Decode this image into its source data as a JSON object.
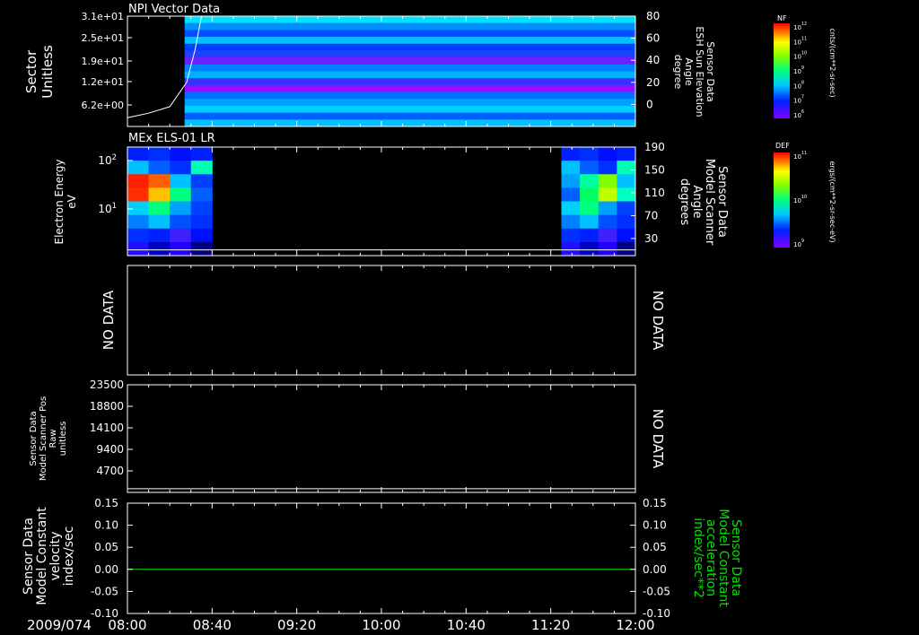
{
  "colors": {
    "background": "#000000",
    "foreground": "#ffffff",
    "green_axis": "#00e000"
  },
  "time_axis": {
    "date": "2009/074",
    "ticks": [
      "08:00",
      "08:40",
      "09:20",
      "10:00",
      "10:40",
      "11:20",
      "12:00"
    ]
  },
  "chart_data": [
    {
      "type": "heatmap",
      "title": "NPI Vector Data",
      "ylabel": [
        "Sector",
        "Unitless"
      ],
      "ytick_labels": [
        "3.1e+01",
        "2.5e+01",
        "1.9e+01",
        "1.2e+01",
        "6.2e+00"
      ],
      "y2label": [
        "Sensor Data",
        "ESH Sun Elevation",
        "Angle",
        "degree"
      ],
      "y2tick_labels": [
        "80",
        "60",
        "40",
        "20",
        "0"
      ],
      "y2lim": [
        -20,
        80
      ],
      "overlay_line": {
        "x": [
          "08:00",
          "08:10",
          "08:20",
          "08:28",
          "08:32",
          "08:35",
          "09:00",
          "10:00",
          "11:00",
          "11:50",
          "11:55",
          "12:00"
        ],
        "y": [
          -12,
          -8,
          -2,
          20,
          50,
          80,
          80,
          80,
          80,
          80,
          82,
          80
        ]
      },
      "data_start": "08:27",
      "colorbar": {
        "label": "NF",
        "units": "cnts/(cm**2-sr-sec)",
        "tick_labels": [
          "10^12",
          "10^11",
          "10^10",
          "10^9",
          "10^8",
          "10^7",
          "10^6"
        ]
      }
    },
    {
      "type": "heatmap",
      "title": "MEx ELS-01 LR",
      "ylabel": [
        "Electron Energy",
        "eV"
      ],
      "ytick_labels": [
        "10^2",
        "10^1"
      ],
      "y2label": [
        "Sensor Data",
        "Model Scanner",
        "Angle",
        "degrees"
      ],
      "y2tick_labels": [
        "190",
        "150",
        "110",
        "70",
        "30"
      ],
      "y2lim": [
        0,
        190
      ],
      "data_segments": [
        [
          "08:00",
          "08:40"
        ],
        [
          "11:25",
          "12:00"
        ]
      ],
      "overlay_line_y2": 10,
      "colorbar": {
        "label": "DEF",
        "units": "ergs/(cm**2-sr-sec-eV)",
        "tick_labels": [
          "10^11",
          "10^10",
          "10^9"
        ]
      }
    },
    {
      "type": "line",
      "ylabel": "NO DATA",
      "y2label": "NO DATA"
    },
    {
      "type": "line",
      "ylabel": [
        "Sensor Data",
        "Model Scanner Pos",
        "Raw",
        "unitless"
      ],
      "ytick_labels": [
        "23500",
        "18800",
        "14100",
        "9400",
        "4700"
      ],
      "ylim": [
        0,
        23500
      ],
      "overlay_line_y": 800,
      "y2label": "NO DATA"
    },
    {
      "type": "line",
      "ylabel": [
        "Sensor Data",
        "Model Constant",
        "velocity",
        "index/sec"
      ],
      "ytick_labels": [
        "0.15",
        "0.10",
        "0.05",
        "0.00",
        "-0.05",
        "-0.10"
      ],
      "ylim": [
        -0.1,
        0.15
      ],
      "y2label": [
        "Sensor Data",
        "Model Constant",
        "acceleration",
        "index/sec**2"
      ],
      "y2tick_labels": [
        "0.15",
        "0.10",
        "0.05",
        "0.00",
        "-0.05",
        "-0.10"
      ],
      "series": [
        {
          "x": [
            "08:00",
            "12:00"
          ],
          "y": [
            0.0,
            0.0
          ]
        }
      ]
    }
  ]
}
